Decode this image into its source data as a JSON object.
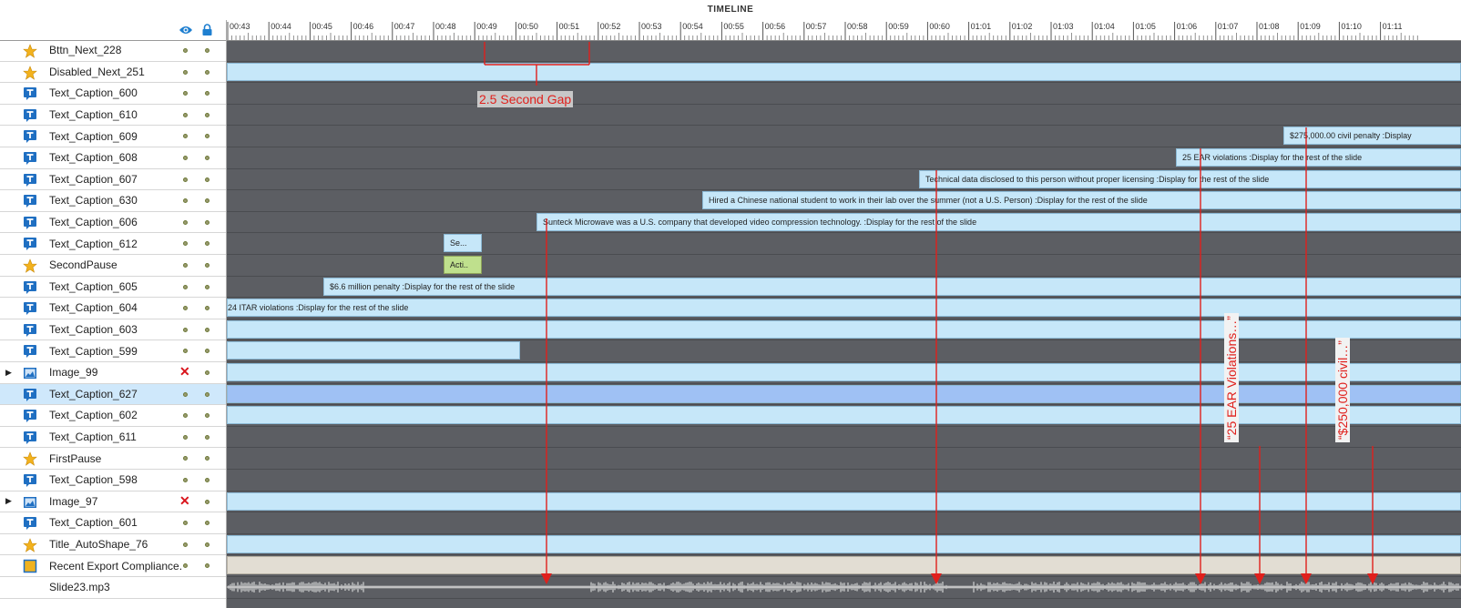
{
  "panel_title": "TIMELINE",
  "ruler_labels": [
    "00:43",
    "00:44",
    "00:45",
    "00:46",
    "00:47",
    "00:48",
    "00:49",
    "00:50",
    "00:51",
    "00:52",
    "00:53",
    "00:54",
    "00:55",
    "00:56",
    "00:57",
    "00:58",
    "00:59",
    "00:60",
    "01:01",
    "01:02",
    "01:03",
    "01:04",
    "01:05",
    "01:06",
    "01:07",
    "01:08",
    "01:09",
    "01:10",
    "01:11"
  ],
  "rows": [
    {
      "name": "Bttn_Next_228",
      "icon": "star-icon",
      "bar": null
    },
    {
      "name": "Disabled_Next_251",
      "icon": "star-icon",
      "bar": {
        "start": 0,
        "text": ""
      }
    },
    {
      "name": "Text_Caption_600",
      "icon": "caption-icon",
      "bar": null
    },
    {
      "name": "Text_Caption_610",
      "icon": "caption-icon",
      "bar": null
    },
    {
      "name": "Text_Caption_609",
      "icon": "caption-icon",
      "bar": {
        "start": 1160,
        "text": "$275,000.00 civil penalty :Display"
      }
    },
    {
      "name": "Text_Caption_608",
      "icon": "caption-icon",
      "bar": {
        "start": 1042,
        "text": "25 EAR violations :Display for the rest of the slide"
      }
    },
    {
      "name": "Text_Caption_607",
      "icon": "caption-icon",
      "bar": {
        "start": 760,
        "text": "Technical data disclosed to this person without proper licensing :Display for the rest of the slide"
      }
    },
    {
      "name": "Text_Caption_630",
      "icon": "caption-icon",
      "bar": {
        "start": 522,
        "text": "Hired a Chinese national student to work in their lab over the summer (not a U.S. Person) :Display for the rest of the slide"
      }
    },
    {
      "name": "Text_Caption_606",
      "icon": "caption-icon",
      "bar": {
        "start": 340,
        "text": "Sunteck Microwave was a U.S. company that developed video compression technology. :Display for the rest of the slide"
      }
    },
    {
      "name": "Text_Caption_612",
      "icon": "caption-icon",
      "bar": {
        "start": 238,
        "end": 280,
        "text": "Se..."
      }
    },
    {
      "name": "SecondPause",
      "icon": "star-icon",
      "bar": {
        "start": 238,
        "end": 280,
        "text": "Acti..",
        "green": true
      }
    },
    {
      "name": "Text_Caption_605",
      "icon": "caption-icon",
      "bar": {
        "start": 106,
        "text": "$6.6 million penalty :Display for the rest of the slide"
      }
    },
    {
      "name": "Text_Caption_604",
      "icon": "caption-icon",
      "bar": {
        "start": 0,
        "text": "24 ITAR violations :Display for the rest of the slide"
      }
    },
    {
      "name": "Text_Caption_603",
      "icon": "caption-icon",
      "bar": {
        "start": 0,
        "text": ""
      }
    },
    {
      "name": "Text_Caption_599",
      "icon": "caption-icon",
      "bar": {
        "start": 0,
        "end": 322,
        "text": ""
      }
    },
    {
      "name": "Image_99",
      "icon": "image-icon",
      "expand": true,
      "hidden": true,
      "bar": {
        "start": 0,
        "text": ""
      }
    },
    {
      "name": "Text_Caption_627",
      "icon": "caption-icon",
      "selected": true,
      "bar": {
        "start": 0,
        "text": "",
        "sel": true
      }
    },
    {
      "name": "Text_Caption_602",
      "icon": "caption-icon",
      "bar": {
        "start": 0,
        "text": ""
      }
    },
    {
      "name": "Text_Caption_611",
      "icon": "caption-icon",
      "bar": null
    },
    {
      "name": "FirstPause",
      "icon": "star-icon",
      "bar": null
    },
    {
      "name": "Text_Caption_598",
      "icon": "caption-icon",
      "bar": null
    },
    {
      "name": "Image_97",
      "icon": "image-icon",
      "expand": true,
      "hidden": true,
      "bar": {
        "start": 0,
        "text": ""
      }
    },
    {
      "name": "Text_Caption_601",
      "icon": "caption-icon",
      "bar": null
    },
    {
      "name": "Title_AutoShape_76",
      "icon": "star-icon",
      "bar": {
        "start": 0,
        "text": ""
      }
    },
    {
      "name": "Recent Export Compliance...",
      "icon": "shape-icon",
      "bar": {
        "start": 0,
        "text": "",
        "beige": true
      }
    },
    {
      "name": "Slide23.mp3",
      "icon": "none",
      "audio": true,
      "bar": null
    }
  ],
  "annotations": {
    "gap_label": "2.5 Second Gap",
    "vertical_1": "“25 EAR Violations…”",
    "vertical_2": "“$250,000 civil…”"
  },
  "colors": {
    "accent_red": "#e0201c",
    "track_bg": "#5c5e63",
    "bar_blue": "#c6e7f9",
    "bar_selected": "#9fc1f4"
  }
}
